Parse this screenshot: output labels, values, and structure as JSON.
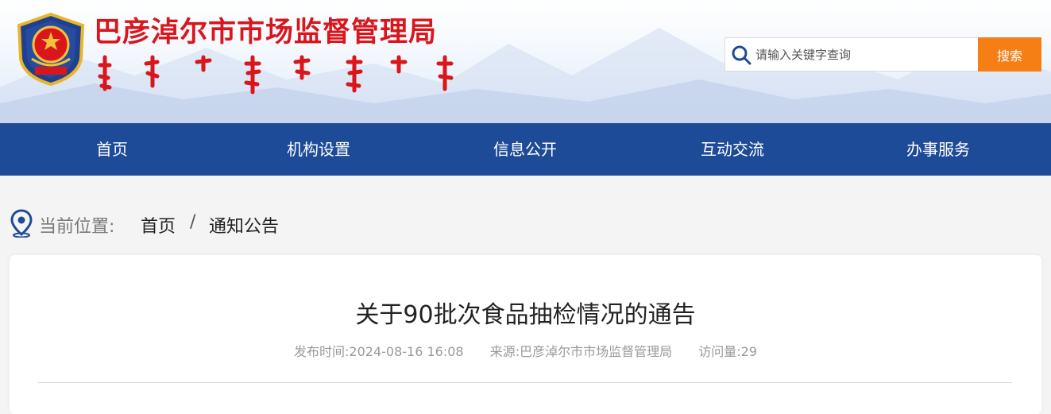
{
  "header": {
    "site_title": "巴彦淖尔市市场监督管理局",
    "title_color": "#d8161b"
  },
  "search": {
    "placeholder": "请输入关键字查询",
    "button_label": "搜索",
    "button_color": "#f57f14"
  },
  "nav": {
    "background": "#1e4b98",
    "items": [
      {
        "label": "首页"
      },
      {
        "label": "机构设置"
      },
      {
        "label": "信息公开"
      },
      {
        "label": "互动交流"
      },
      {
        "label": "办事服务"
      }
    ]
  },
  "breadcrumb": {
    "label": "当前位置:",
    "items": [
      "首页",
      "通知公告"
    ],
    "separator": "/"
  },
  "article": {
    "title": "关于90批次食品抽检情况的通告",
    "publish_time": "发布时间:2024-08-16 16:08",
    "source": "来源:巴彦淖尔市市场监督管理局",
    "views": "访问量:29"
  }
}
